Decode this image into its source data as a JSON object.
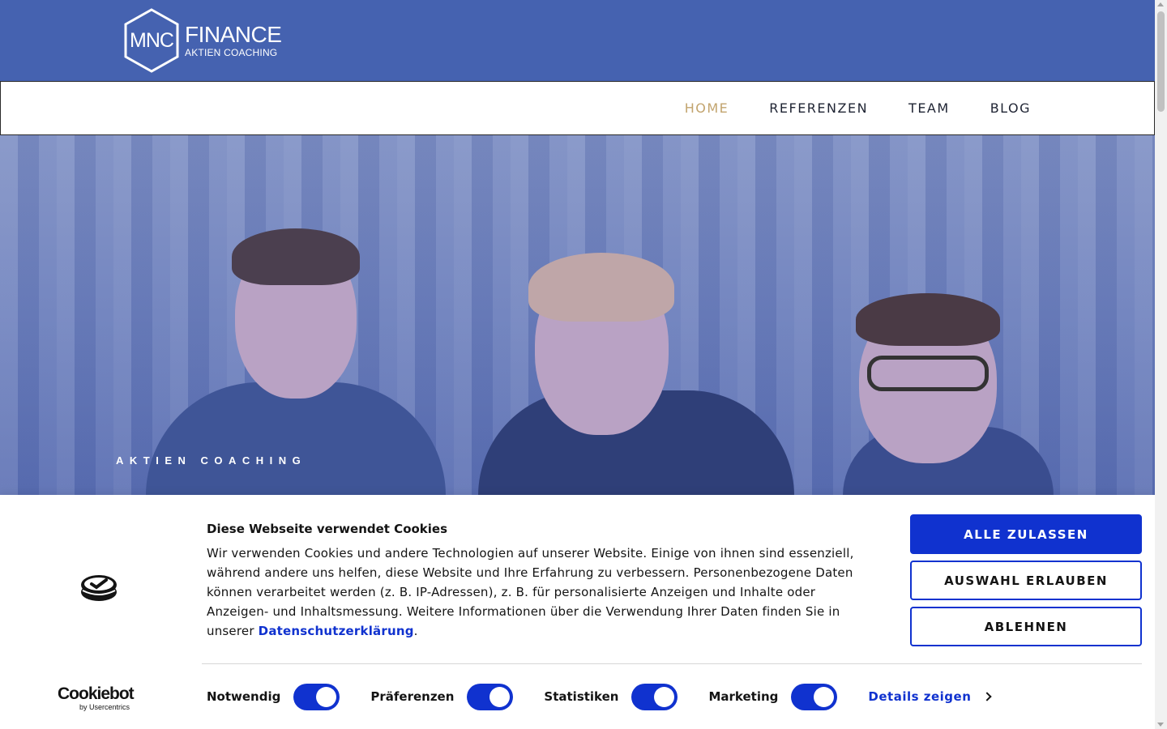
{
  "header": {
    "logo_mark": "MNC",
    "logo_brand": "FINANCE",
    "logo_sub": "AKTIEN COACHING",
    "bg_color": "#4562b0"
  },
  "nav": {
    "items": [
      {
        "label": "HOME",
        "active": true
      },
      {
        "label": "REFERENZEN",
        "active": false
      },
      {
        "label": "TEAM",
        "active": false
      },
      {
        "label": "BLOG",
        "active": false
      }
    ],
    "active_color": "#c2a46e"
  },
  "hero": {
    "tagline": "AKTIEN COACHING"
  },
  "cookie_banner": {
    "title": "Diese Webseite verwendet Cookies",
    "text": "Wir verwenden Cookies und andere Technologien auf unserer Website. Einige von ihnen sind essenziell, während andere uns helfen, diese Website und Ihre Erfahrung zu verbessern. Personenbezogene Daten können verarbeitet werden (z. B. IP-Adressen), z. B. für personalisierte Anzeigen und Inhalte oder Anzeigen- und Inhaltsmessung. Weitere Informationen über die Verwendung Ihrer Daten finden Sie in unserer",
    "privacy_link": "Datenschutzerklärung",
    "period": ".",
    "buttons": {
      "allow_all": "ALLE ZULASSEN",
      "allow_selection": "AUSWAHL ERLAUBEN",
      "deny": "ABLEHNEN"
    },
    "toggles": [
      {
        "label": "Notwendig",
        "on": true
      },
      {
        "label": "Präferenzen",
        "on": true
      },
      {
        "label": "Statistiken",
        "on": true
      },
      {
        "label": "Marketing",
        "on": true
      }
    ],
    "details_label": "Details zeigen",
    "brand_main": "Cookiebot",
    "brand_sub": "by Usercentrics",
    "accent_color": "#1032cf"
  }
}
